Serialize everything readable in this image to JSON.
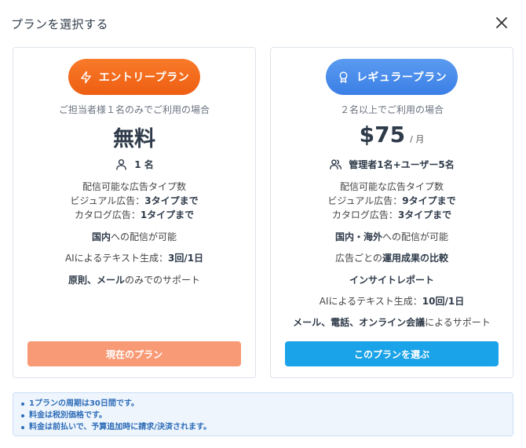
{
  "modal": {
    "title": "プランを選択する"
  },
  "plans": [
    {
      "badge_label": "エントリープラン",
      "badge_icon": "lightning-icon",
      "subtitle": "ご担当者様１名のみでご利用の場合",
      "price": "無料",
      "price_unit": "",
      "users_icon": "user-icon",
      "users_label": "1 名",
      "ad_types_heading": "配信可能な広告タイプ数",
      "visual_ads_prefix": "ビジュアル広告：",
      "visual_ads_value": "3タイプまで",
      "catalog_ads_prefix": "カタログ広告：",
      "catalog_ads_value": "1タイプまで",
      "delivery_bold": "国内",
      "delivery_rest": "への配信が可能",
      "ai_prefix": "AIによるテキスト生成：",
      "ai_value": "3回/1日",
      "support_bold1": "原則、メール",
      "support_rest": "のみでのサポート",
      "button_label": "現在のプラン"
    },
    {
      "badge_label": "レギュラープラン",
      "badge_icon": "award-icon",
      "subtitle": "２名以上でご利用の場合",
      "price": "$75",
      "price_unit": "/ 月",
      "users_icon": "users-icon",
      "users_label": "管理者1名+ユーザー5名",
      "ad_types_heading": "配信可能な広告タイプ数",
      "visual_ads_prefix": "ビジュアル広告：",
      "visual_ads_value": "9タイプまで",
      "catalog_ads_prefix": "カタログ広告：",
      "catalog_ads_value": "3タイプまで",
      "delivery_bold": "国内・海外",
      "delivery_rest": "への配信が可能",
      "comparison_prefix": "広告ごとの",
      "comparison_bold": "運用成果の比較",
      "insight_label": "インサイトレポート",
      "ai_prefix": "AIによるテキスト生成：",
      "ai_value": "10回/1日",
      "support_bold1": "メール、電話、オンライン会議",
      "support_rest": "によるサポート",
      "button_label": "このプランを選ぶ"
    }
  ],
  "notes": [
    "1プランの周期は30日間です。",
    "料金は税別価格です。",
    "料金は前払いで、予算追加時に請求/決済されます。"
  ],
  "colors": {
    "entry_badge": "#f26a1b",
    "entry_button": "#f99a76",
    "regular_badge": "#3b7fe6",
    "regular_button": "#1aa3e8",
    "notes_text": "#2e6db8",
    "notes_bg": "#eef5fd"
  }
}
